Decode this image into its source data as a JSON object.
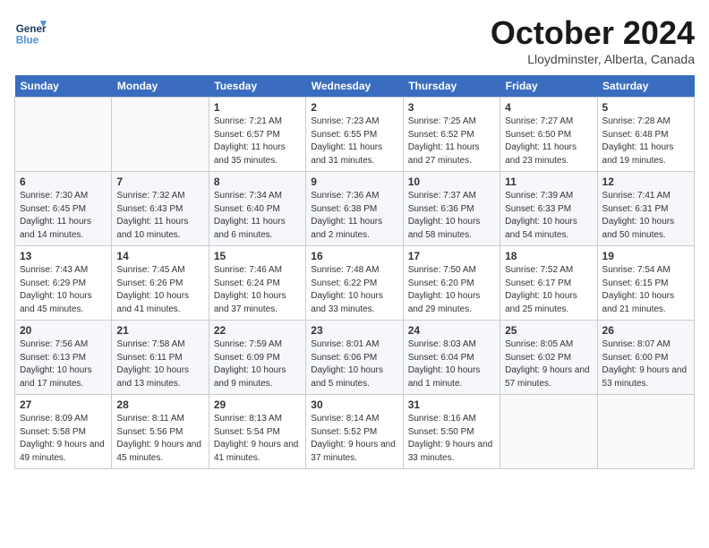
{
  "header": {
    "logo_line1": "General",
    "logo_line2": "Blue",
    "month": "October 2024",
    "location": "Lloydminster, Alberta, Canada"
  },
  "days_of_week": [
    "Sunday",
    "Monday",
    "Tuesday",
    "Wednesday",
    "Thursday",
    "Friday",
    "Saturday"
  ],
  "weeks": [
    [
      {
        "num": "",
        "detail": ""
      },
      {
        "num": "",
        "detail": ""
      },
      {
        "num": "1",
        "detail": "Sunrise: 7:21 AM\nSunset: 6:57 PM\nDaylight: 11 hours\nand 35 minutes."
      },
      {
        "num": "2",
        "detail": "Sunrise: 7:23 AM\nSunset: 6:55 PM\nDaylight: 11 hours\nand 31 minutes."
      },
      {
        "num": "3",
        "detail": "Sunrise: 7:25 AM\nSunset: 6:52 PM\nDaylight: 11 hours\nand 27 minutes."
      },
      {
        "num": "4",
        "detail": "Sunrise: 7:27 AM\nSunset: 6:50 PM\nDaylight: 11 hours\nand 23 minutes."
      },
      {
        "num": "5",
        "detail": "Sunrise: 7:28 AM\nSunset: 6:48 PM\nDaylight: 11 hours\nand 19 minutes."
      }
    ],
    [
      {
        "num": "6",
        "detail": "Sunrise: 7:30 AM\nSunset: 6:45 PM\nDaylight: 11 hours\nand 14 minutes."
      },
      {
        "num": "7",
        "detail": "Sunrise: 7:32 AM\nSunset: 6:43 PM\nDaylight: 11 hours\nand 10 minutes."
      },
      {
        "num": "8",
        "detail": "Sunrise: 7:34 AM\nSunset: 6:40 PM\nDaylight: 11 hours\nand 6 minutes."
      },
      {
        "num": "9",
        "detail": "Sunrise: 7:36 AM\nSunset: 6:38 PM\nDaylight: 11 hours\nand 2 minutes."
      },
      {
        "num": "10",
        "detail": "Sunrise: 7:37 AM\nSunset: 6:36 PM\nDaylight: 10 hours\nand 58 minutes."
      },
      {
        "num": "11",
        "detail": "Sunrise: 7:39 AM\nSunset: 6:33 PM\nDaylight: 10 hours\nand 54 minutes."
      },
      {
        "num": "12",
        "detail": "Sunrise: 7:41 AM\nSunset: 6:31 PM\nDaylight: 10 hours\nand 50 minutes."
      }
    ],
    [
      {
        "num": "13",
        "detail": "Sunrise: 7:43 AM\nSunset: 6:29 PM\nDaylight: 10 hours\nand 45 minutes."
      },
      {
        "num": "14",
        "detail": "Sunrise: 7:45 AM\nSunset: 6:26 PM\nDaylight: 10 hours\nand 41 minutes."
      },
      {
        "num": "15",
        "detail": "Sunrise: 7:46 AM\nSunset: 6:24 PM\nDaylight: 10 hours\nand 37 minutes."
      },
      {
        "num": "16",
        "detail": "Sunrise: 7:48 AM\nSunset: 6:22 PM\nDaylight: 10 hours\nand 33 minutes."
      },
      {
        "num": "17",
        "detail": "Sunrise: 7:50 AM\nSunset: 6:20 PM\nDaylight: 10 hours\nand 29 minutes."
      },
      {
        "num": "18",
        "detail": "Sunrise: 7:52 AM\nSunset: 6:17 PM\nDaylight: 10 hours\nand 25 minutes."
      },
      {
        "num": "19",
        "detail": "Sunrise: 7:54 AM\nSunset: 6:15 PM\nDaylight: 10 hours\nand 21 minutes."
      }
    ],
    [
      {
        "num": "20",
        "detail": "Sunrise: 7:56 AM\nSunset: 6:13 PM\nDaylight: 10 hours\nand 17 minutes."
      },
      {
        "num": "21",
        "detail": "Sunrise: 7:58 AM\nSunset: 6:11 PM\nDaylight: 10 hours\nand 13 minutes."
      },
      {
        "num": "22",
        "detail": "Sunrise: 7:59 AM\nSunset: 6:09 PM\nDaylight: 10 hours\nand 9 minutes."
      },
      {
        "num": "23",
        "detail": "Sunrise: 8:01 AM\nSunset: 6:06 PM\nDaylight: 10 hours\nand 5 minutes."
      },
      {
        "num": "24",
        "detail": "Sunrise: 8:03 AM\nSunset: 6:04 PM\nDaylight: 10 hours\nand 1 minute."
      },
      {
        "num": "25",
        "detail": "Sunrise: 8:05 AM\nSunset: 6:02 PM\nDaylight: 9 hours\nand 57 minutes."
      },
      {
        "num": "26",
        "detail": "Sunrise: 8:07 AM\nSunset: 6:00 PM\nDaylight: 9 hours\nand 53 minutes."
      }
    ],
    [
      {
        "num": "27",
        "detail": "Sunrise: 8:09 AM\nSunset: 5:58 PM\nDaylight: 9 hours\nand 49 minutes."
      },
      {
        "num": "28",
        "detail": "Sunrise: 8:11 AM\nSunset: 5:56 PM\nDaylight: 9 hours\nand 45 minutes."
      },
      {
        "num": "29",
        "detail": "Sunrise: 8:13 AM\nSunset: 5:54 PM\nDaylight: 9 hours\nand 41 minutes."
      },
      {
        "num": "30",
        "detail": "Sunrise: 8:14 AM\nSunset: 5:52 PM\nDaylight: 9 hours\nand 37 minutes."
      },
      {
        "num": "31",
        "detail": "Sunrise: 8:16 AM\nSunset: 5:50 PM\nDaylight: 9 hours\nand 33 minutes."
      },
      {
        "num": "",
        "detail": ""
      },
      {
        "num": "",
        "detail": ""
      }
    ]
  ]
}
